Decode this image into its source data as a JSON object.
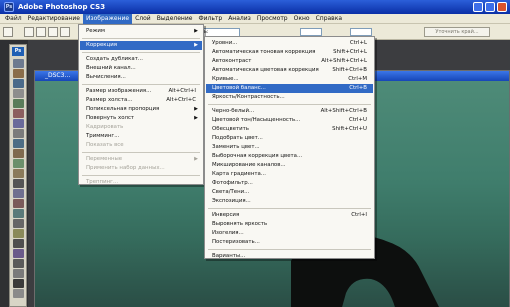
{
  "window": {
    "title": "Adobe Photoshop CS3",
    "icon_text": "Ps"
  },
  "menubar": [
    "Файл",
    "Редактирование",
    "Изображение",
    "Слой",
    "Выделение",
    "Фильтр",
    "Анализ",
    "Просмотр",
    "Окно",
    "Справка"
  ],
  "options_bar": {
    "style_select": "Стиль: Нормальный",
    "refine_edge_label": "Уточнить край..."
  },
  "document": {
    "title": "_DSC3…"
  },
  "toolbox": {
    "badge": "Ps"
  },
  "image_menu": {
    "items": [
      {
        "label": "Режим",
        "shortcut": "",
        "submenu": true,
        "disabled": false
      },
      {
        "sep": true
      },
      {
        "label": "Коррекция",
        "shortcut": "",
        "submenu": true,
        "disabled": false,
        "highlighted": true
      },
      {
        "sep": true
      },
      {
        "label": "Создать дубликат...",
        "shortcut": "",
        "submenu": false,
        "disabled": false
      },
      {
        "label": "Внешний канал...",
        "shortcut": "",
        "submenu": false,
        "disabled": false
      },
      {
        "label": "Вычисления...",
        "shortcut": "",
        "submenu": false,
        "disabled": false
      },
      {
        "sep": true
      },
      {
        "label": "Размер изображения...",
        "shortcut": "Alt+Ctrl+I",
        "submenu": false,
        "disabled": false
      },
      {
        "label": "Размер холста...",
        "shortcut": "Alt+Ctrl+C",
        "submenu": false,
        "disabled": false
      },
      {
        "label": "Попиксельная пропорция",
        "shortcut": "",
        "submenu": true,
        "disabled": false
      },
      {
        "label": "Повернуть холст",
        "shortcut": "",
        "submenu": true,
        "disabled": false
      },
      {
        "label": "Кадрировать",
        "shortcut": "",
        "submenu": false,
        "disabled": true
      },
      {
        "label": "Тримминг...",
        "shortcut": "",
        "submenu": false,
        "disabled": false
      },
      {
        "label": "Показать все",
        "shortcut": "",
        "submenu": false,
        "disabled": true
      },
      {
        "sep": true
      },
      {
        "label": "Переменные",
        "shortcut": "",
        "submenu": true,
        "disabled": true
      },
      {
        "label": "Применить набор данных...",
        "shortcut": "",
        "submenu": false,
        "disabled": true
      },
      {
        "sep": true
      },
      {
        "label": "Треппинг...",
        "shortcut": "",
        "submenu": false,
        "disabled": true
      }
    ]
  },
  "adjust_menu": {
    "items": [
      {
        "label": "Уровни...",
        "shortcut": "Ctrl+L"
      },
      {
        "label": "Автоматическая тоновая коррекция",
        "shortcut": "Shift+Ctrl+L"
      },
      {
        "label": "Автоконтраст",
        "shortcut": "Alt+Shift+Ctrl+L"
      },
      {
        "label": "Автоматическая цветовая коррекция",
        "shortcut": "Shift+Ctrl+B"
      },
      {
        "label": "Кривые...",
        "shortcut": "Ctrl+M"
      },
      {
        "label": "Цветовой баланс...",
        "shortcut": "Ctrl+B",
        "highlighted": true
      },
      {
        "label": "Яркость/Контрастность...",
        "shortcut": ""
      },
      {
        "sep": true
      },
      {
        "label": "Черно-белый...",
        "shortcut": "Alt+Shift+Ctrl+B"
      },
      {
        "label": "Цветовой тон/Насыщенность...",
        "shortcut": "Ctrl+U"
      },
      {
        "label": "Обесцветить",
        "shortcut": "Shift+Ctrl+U"
      },
      {
        "label": "Подобрать цвет...",
        "shortcut": ""
      },
      {
        "label": "Заменить цвет...",
        "shortcut": ""
      },
      {
        "label": "Выборочная коррекция цвета...",
        "shortcut": ""
      },
      {
        "label": "Микширование каналов...",
        "shortcut": ""
      },
      {
        "label": "Карта градиента...",
        "shortcut": ""
      },
      {
        "label": "Фотофильтр...",
        "shortcut": ""
      },
      {
        "label": "Света/Тени...",
        "shortcut": ""
      },
      {
        "label": "Экспозиция...",
        "shortcut": ""
      },
      {
        "sep": true
      },
      {
        "label": "Инверсия",
        "shortcut": "Ctrl+I"
      },
      {
        "label": "Выровнять яркость",
        "shortcut": ""
      },
      {
        "label": "Изогелия...",
        "shortcut": ""
      },
      {
        "label": "Постеризовать...",
        "shortcut": ""
      },
      {
        "sep": true
      },
      {
        "label": "Варианты...",
        "shortcut": ""
      }
    ]
  },
  "colors": {
    "menu_highlight": "#316ac5",
    "titlebar": "#0a2fa6",
    "disabled_text": "#a5a39a"
  }
}
